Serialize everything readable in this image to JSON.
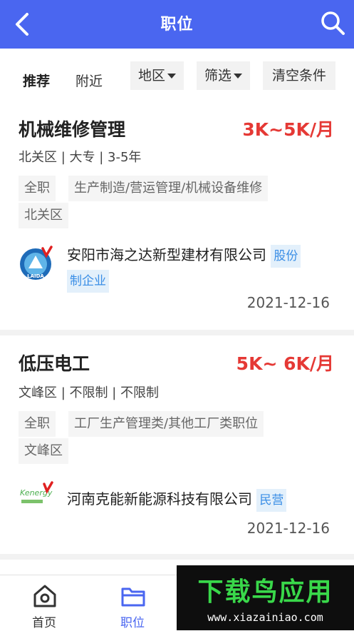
{
  "header": {
    "title": "职位",
    "back_icon": "chevron-left-icon",
    "search_icon": "search-icon"
  },
  "filters": {
    "tabs": [
      {
        "label": "推荐"
      },
      {
        "label": "附近"
      }
    ],
    "buttons": [
      {
        "label": "地区"
      },
      {
        "label": "筛选"
      },
      {
        "label": "清空条件"
      }
    ]
  },
  "jobs": [
    {
      "title": "机械维修管理",
      "salary": "3K~5K/月",
      "meta": "北关区 | 大专 | 3-5年",
      "tags": [
        "全职",
        "生产制造/营运管理/机械设备维修",
        "北关区"
      ],
      "logo_text": "LAIDA",
      "company_line1": "安阳市海之达新型建材有限公司",
      "badge_part1": "股份",
      "badge_part2": "制企业",
      "date": "2021-12-16"
    },
    {
      "title": "低压电工",
      "salary": "5K~ 6K/月",
      "meta": "文峰区 | 不限制 | 不限制",
      "tags": [
        "全职",
        "工厂生产管理类/其他工厂类职位",
        "文峰区"
      ],
      "logo_text": "Kenergy",
      "company_line1": "河南克能新能源科技有限公司",
      "badge": "民营",
      "date": "2021-12-16"
    }
  ],
  "nav": {
    "items": [
      {
        "label": "首页",
        "icon": "home-icon"
      },
      {
        "label": "职位",
        "icon": "folder-icon"
      }
    ],
    "active_color": "#4a66f0"
  },
  "watermark": {
    "text": "下载鸟应用",
    "url": "www.xiazainiao.com"
  },
  "colors": {
    "primary": "#4a66f0",
    "salary": "#e53935",
    "badge": "#3a8ee6"
  }
}
